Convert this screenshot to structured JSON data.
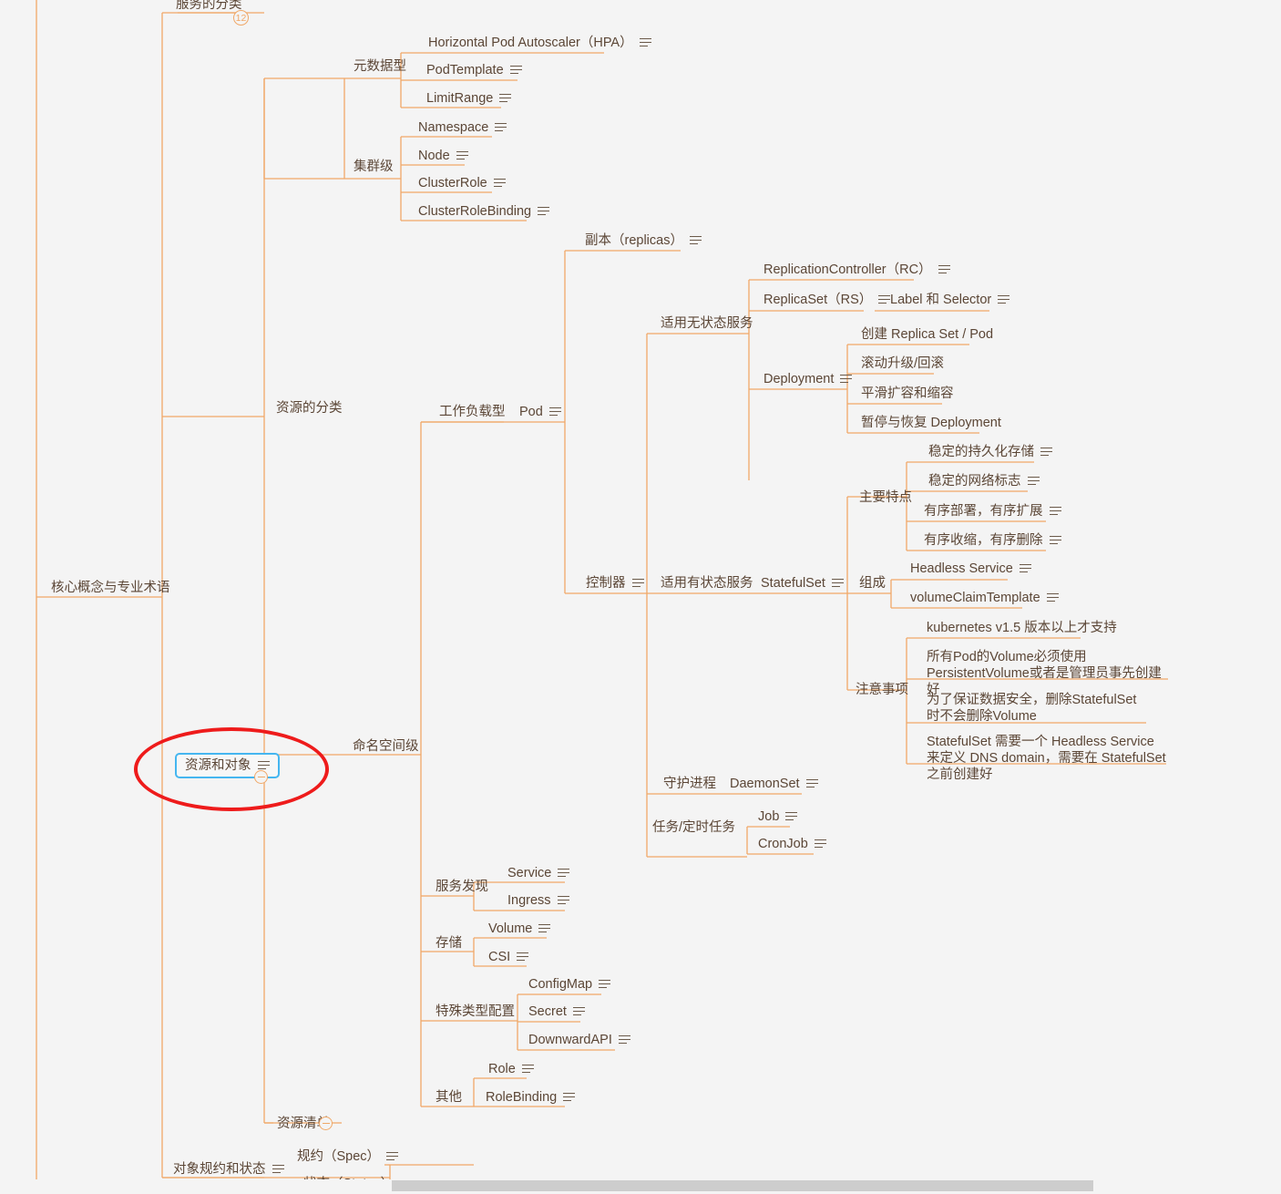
{
  "theme": {
    "background": "#f4f4f4",
    "branch_color": "#f0a868",
    "text_color": "#5b4636",
    "selection_color": "#45b6f0",
    "highlight_color": "#ee1b1b"
  },
  "icons": {
    "notes": "notes-icon",
    "collapse": "minus-circle-icon",
    "badge": "count-badge"
  },
  "root": {
    "label": "核心概念与专业术语"
  },
  "selected_node": {
    "label": "资源和对象"
  },
  "badges": {
    "service_classification_count": "12"
  },
  "nodes": {
    "service_classification": "服务的分类",
    "resource_classification": "资源的分类",
    "resource_manifest": "资源清单",
    "object_spec_status": "对象规约和状态",
    "spec": "规约（Spec）",
    "status": "状态（Status）",
    "metadata_type": "元数据型",
    "hpa": "Horizontal Pod Autoscaler（HPA）",
    "pod_template": "PodTemplate",
    "limit_range": "LimitRange",
    "cluster_level": "集群级",
    "namespace": "Namespace",
    "node": "Node",
    "cluster_role": "ClusterRole",
    "cluster_role_binding": "ClusterRoleBinding",
    "namespace_level": "命名空间级",
    "workload_type": "工作负载型",
    "pod": "Pod",
    "replicas": "副本（replicas）",
    "controller": "控制器",
    "stateless": "适用无状态服务",
    "rc": "ReplicationController（RC）",
    "rs": "ReplicaSet（RS）",
    "label_selector": "Label 和 Selector",
    "deployment": "Deployment",
    "dep_create": "创建 Replica Set / Pod",
    "dep_rolling": "滚动升级/回滚",
    "dep_scale": "平滑扩容和缩容",
    "dep_pause": "暂停与恢复 Deployment",
    "stateful": "适用有状态服务",
    "statefulset": "StatefulSet",
    "main_features": "主要特点",
    "feat_storage": "稳定的持久化存储",
    "feat_network": "稳定的网络标志",
    "feat_deploy": "有序部署，有序扩展",
    "feat_shrink": "有序收缩，有序删除",
    "composition": "组成",
    "headless_service": "Headless Service",
    "volume_claim_template": "volumeClaimTemplate",
    "notes_title": "注意事项",
    "note_version": "kubernetes v1.5 版本以上才支持",
    "note_volume": "所有Pod的Volume必须使用PersistentVolume或者是管理员事先创建好",
    "note_delete": "为了保证数据安全，删除StatefulSet时不会删除Volume",
    "note_dns": "StatefulSet 需要一个 Headless Service 来定义 DNS domain，需要在 StatefulSet 之前创建好",
    "daemon_process": "守护进程",
    "daemonset": "DaemonSet",
    "job_tasks": "任务/定时任务",
    "job": "Job",
    "cronjob": "CronJob",
    "service_discovery": "服务发现",
    "service": "Service",
    "ingress": "Ingress",
    "storage": "存储",
    "volume": "Volume",
    "csi": "CSI",
    "special_config": "特殊类型配置",
    "configmap": "ConfigMap",
    "secret": "Secret",
    "downward_api": "DownwardAPI",
    "other": "其他",
    "role": "Role",
    "role_binding": "RoleBinding"
  }
}
